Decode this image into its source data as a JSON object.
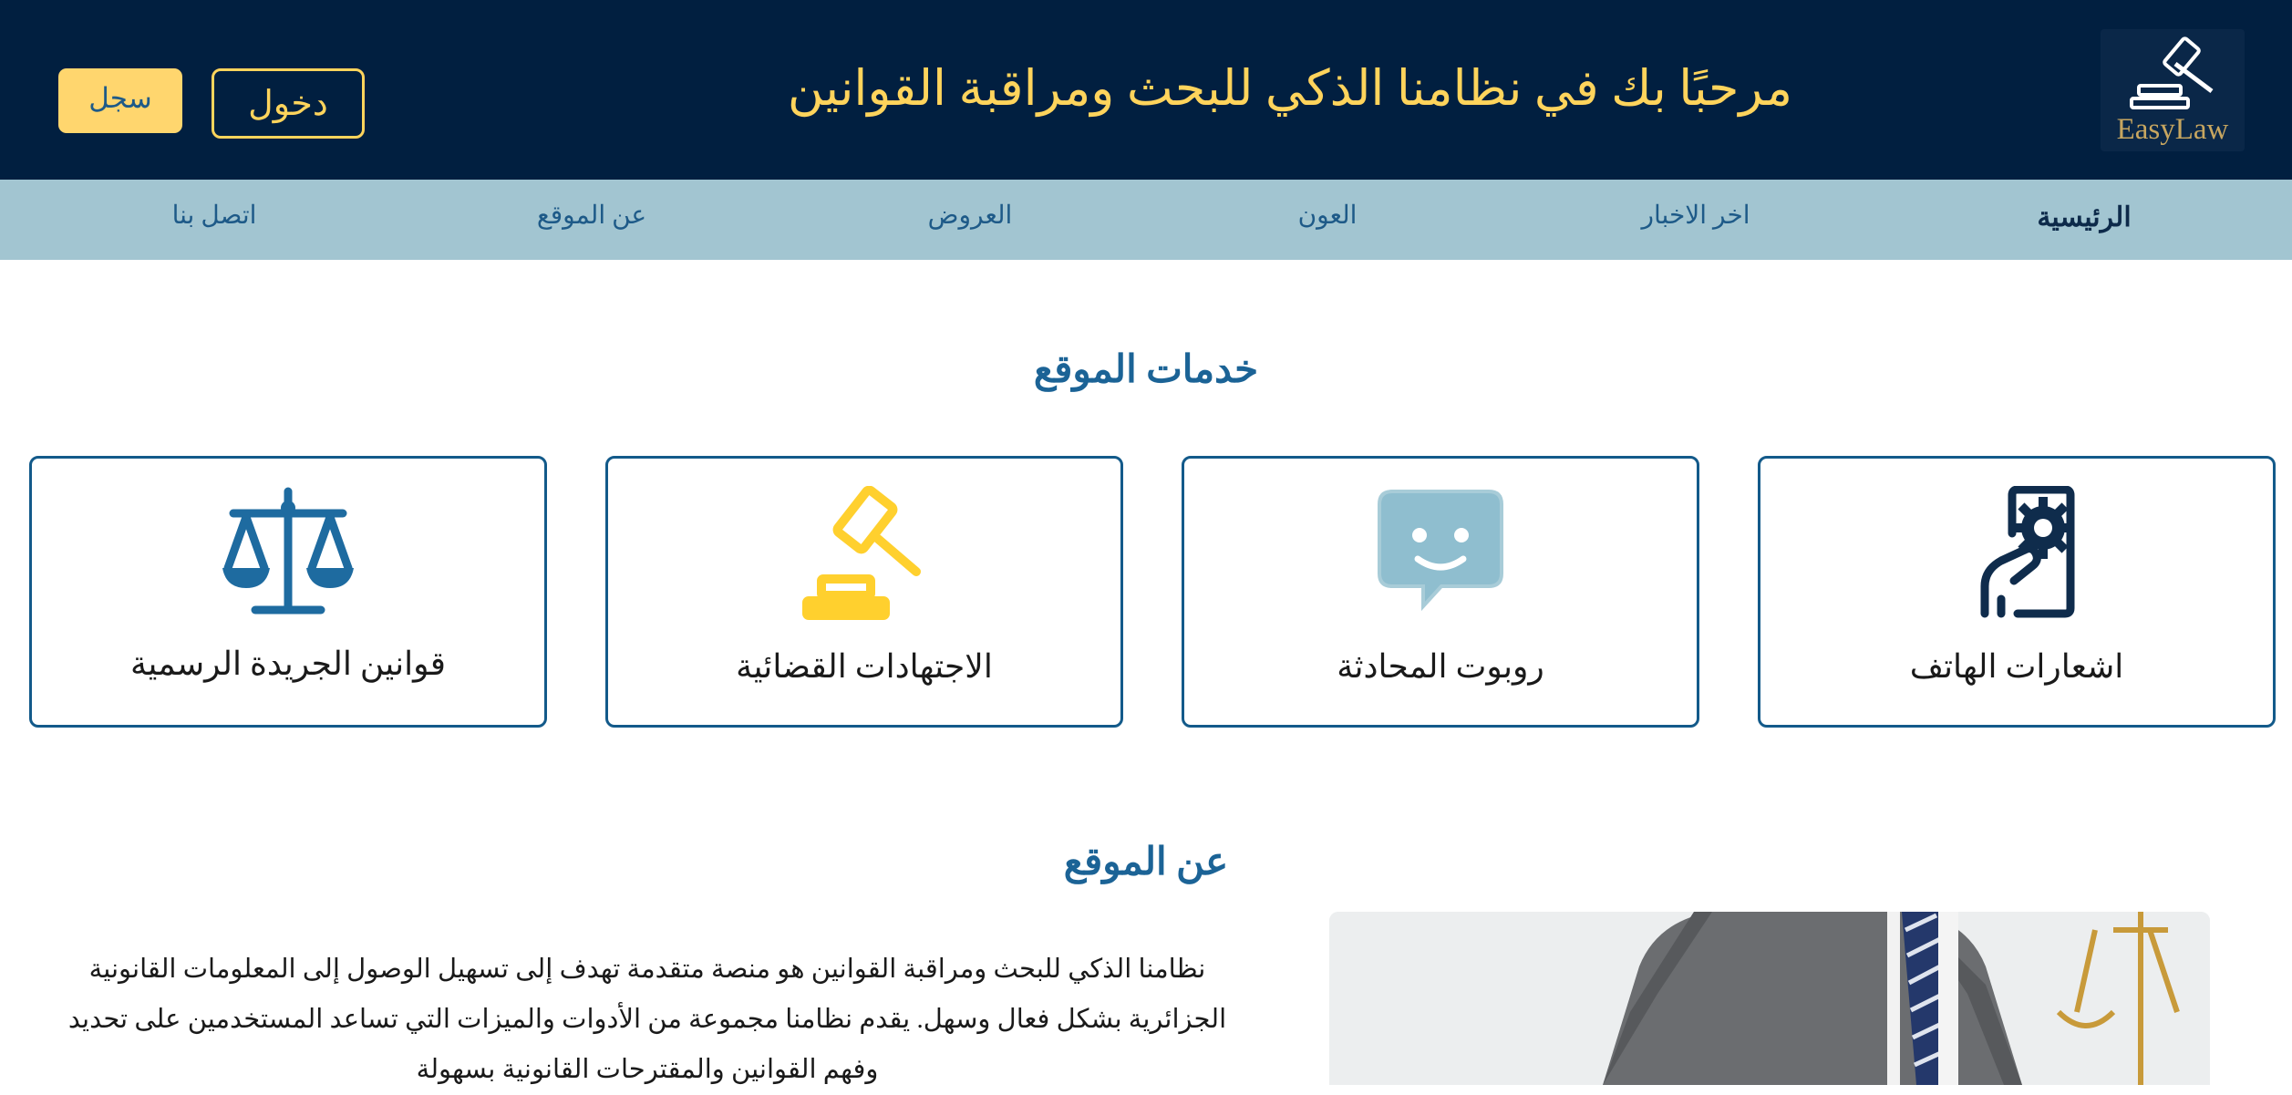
{
  "header": {
    "logo_text": "EasyLaw",
    "welcome": "مرحبًا بك في نظامنا الذكي للبحث ومراقبة القوانين",
    "login_label": "دخول",
    "register_label": "سجل"
  },
  "nav": {
    "items": [
      {
        "label": "الرئيسية",
        "active": true
      },
      {
        "label": "اخر الاخبار",
        "active": false
      },
      {
        "label": "العون",
        "active": false
      },
      {
        "label": "العروض",
        "active": false
      },
      {
        "label": "عن الموقع",
        "active": false
      },
      {
        "label": "اتصل بنا",
        "active": false
      }
    ]
  },
  "services": {
    "title": "خدمات الموقع",
    "cards": [
      {
        "label": "اشعارات الهاتف",
        "icon": "phone-notification-gear-icon"
      },
      {
        "label": "روبوت المحادثة",
        "icon": "chatbot-icon"
      },
      {
        "label": "الاجتهادات القضائية",
        "icon": "gavel-icon"
      },
      {
        "label": "قوانين الجريدة الرسمية",
        "icon": "scales-of-justice-icon"
      }
    ]
  },
  "about": {
    "title": "عن الموقع",
    "lines": [
      "نظامنا الذكي للبحث ومراقبة القوانين هو منصة متقدمة تهدف إلى تسهيل الوصول إلى المعلومات القانونية",
      "الجزائرية بشكل فعال وسهل. يقدم نظامنا مجموعة من الأدوات والميزات التي تساعد المستخدمين على تحديد",
      "وفهم القوانين والمقترحات القانونية بسهولة"
    ]
  },
  "colors": {
    "header_bg": "#011f40",
    "accent_yellow": "#ffd45c",
    "nav_bg": "#a2c5d1",
    "primary_blue": "#1b6396"
  }
}
